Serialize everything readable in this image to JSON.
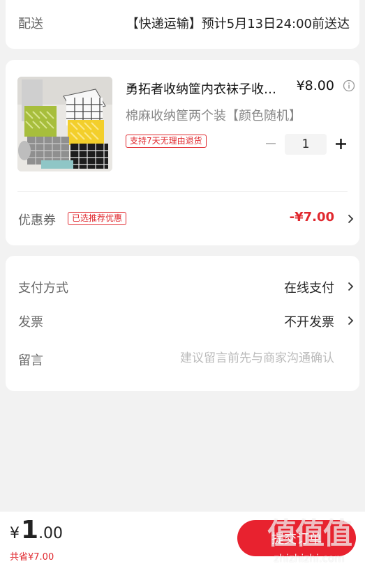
{
  "delivery": {
    "label": "配送",
    "value": "【快递运输】预计5月13日24:00前送达"
  },
  "product": {
    "title": "勇拓者收纳筐内衣袜子收纳盒",
    "price": "¥8.00",
    "spec": "棉麻收纳筐两个装【颜色随机】",
    "return_tag": "支持7天无理由退货",
    "quantity": "1",
    "image_icon": "storage-basket-photo",
    "info_icon": "info-icon"
  },
  "coupon": {
    "label": "优惠券",
    "tag": "已选推荐优惠",
    "value": "-¥7.00"
  },
  "payment": {
    "label": "支付方式",
    "value": "在线支付"
  },
  "invoice": {
    "label": "发票",
    "value": "不开发票"
  },
  "message": {
    "label": "留言",
    "placeholder": "建议留言前先与商家沟通确认"
  },
  "bottom": {
    "currency": "¥",
    "total_int": "1",
    "total_dec": ".00",
    "saved": "共省¥7.00",
    "submit_label": "提交订单"
  },
  "watermark": {
    "logo": "值值值",
    "url": "zhizhizhi.com"
  },
  "colors": {
    "accent": "#e8222f",
    "price_red": "#e0282e",
    "background": "#f2f2f2"
  }
}
